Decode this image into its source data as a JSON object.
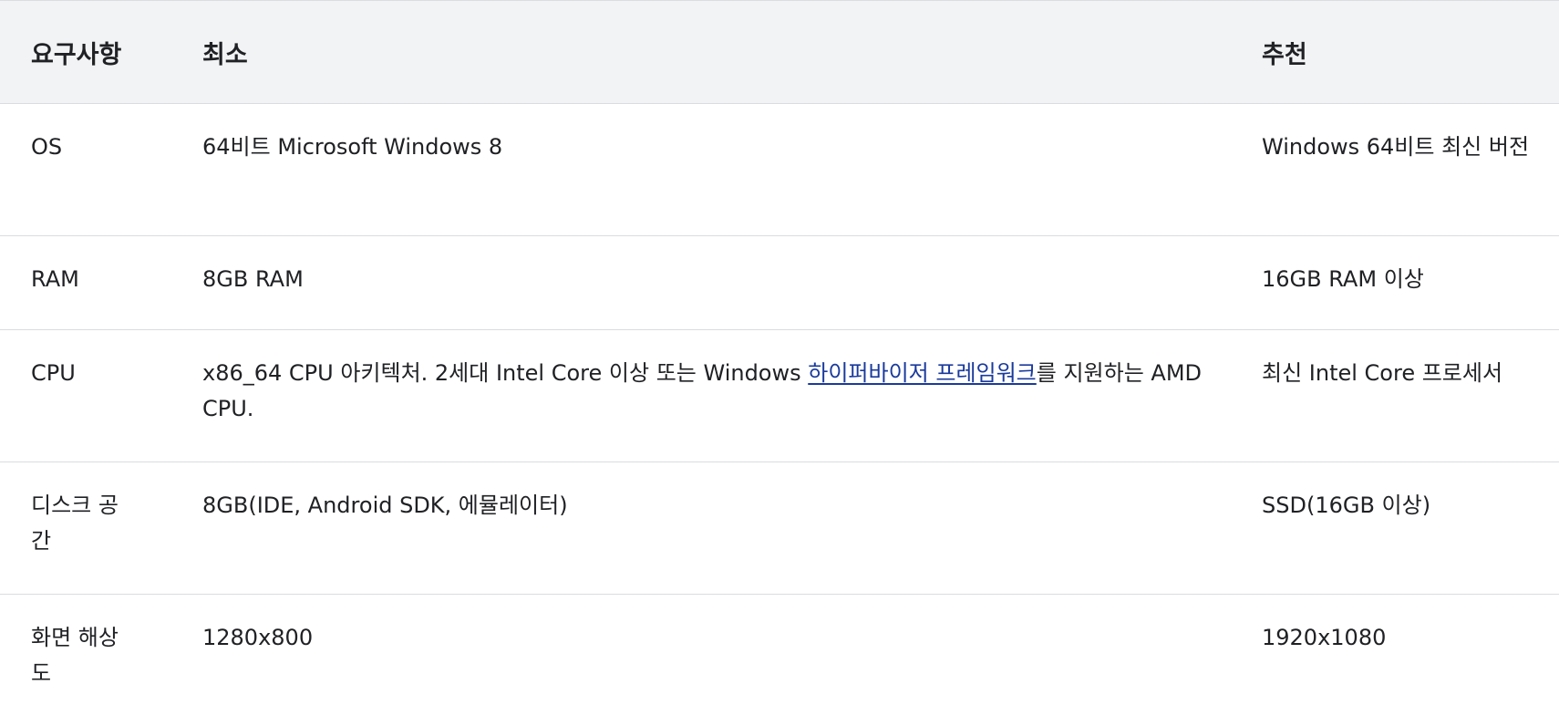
{
  "headers": {
    "requirement": "요구사항",
    "minimum": "최소",
    "recommended": "추천"
  },
  "rows": [
    {
      "requirement": "OS",
      "minimum": "64비트 Microsoft Windows 8",
      "recommended": "Windows 64비트 최신 버전"
    },
    {
      "requirement": "RAM",
      "minimum": "8GB RAM",
      "recommended": "16GB RAM 이상"
    },
    {
      "requirement": "CPU",
      "minimum_before": "x86_64 CPU 아키텍처. 2세대 Intel Core 이상 또는 Windows ",
      "minimum_link": "하이퍼바이저 프레임워크",
      "minimum_after": "를 지원하는 AMD CPU.",
      "recommended": "최신 Intel Core 프로세서"
    },
    {
      "requirement": "디스크 공간",
      "minimum": "8GB(IDE, Android SDK, 에뮬레이터)",
      "recommended": "SSD(16GB 이상)"
    },
    {
      "requirement": "화면 해상도",
      "minimum": "1280x800",
      "recommended": "1920x1080"
    }
  ],
  "colors": {
    "header_bg": "#f1f3f4",
    "border": "#dadce0",
    "text": "#202124",
    "link": "#1a3a9c"
  }
}
